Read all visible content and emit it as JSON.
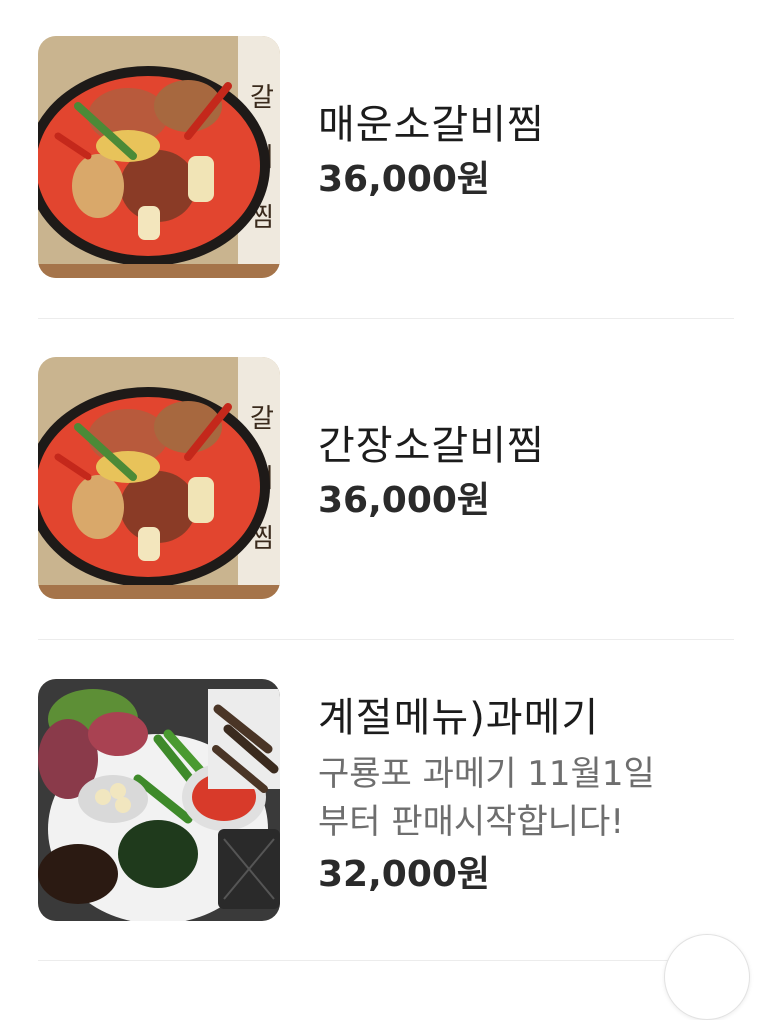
{
  "menu": {
    "items": [
      {
        "name": "매운소갈비찜",
        "price": "36,000원",
        "image": "spicy-galbi-jjim-painting"
      },
      {
        "name": "간장소갈비찜",
        "price": "36,000원",
        "image": "soy-galbi-jjim-painting"
      },
      {
        "name": "계절메뉴)과메기",
        "description_line1": "구룡포 과메기 11월1일",
        "description_line2": "부터 판매시작합니다!",
        "price": "32,000원",
        "image": "gwamegi-platter-photo"
      }
    ]
  },
  "colors": {
    "background": "#ffffff",
    "divider": "#ececec",
    "text": "#1c1c1c",
    "description": "#6e6e6e"
  },
  "scroll_button": {
    "icon": "scroll-top-icon"
  }
}
